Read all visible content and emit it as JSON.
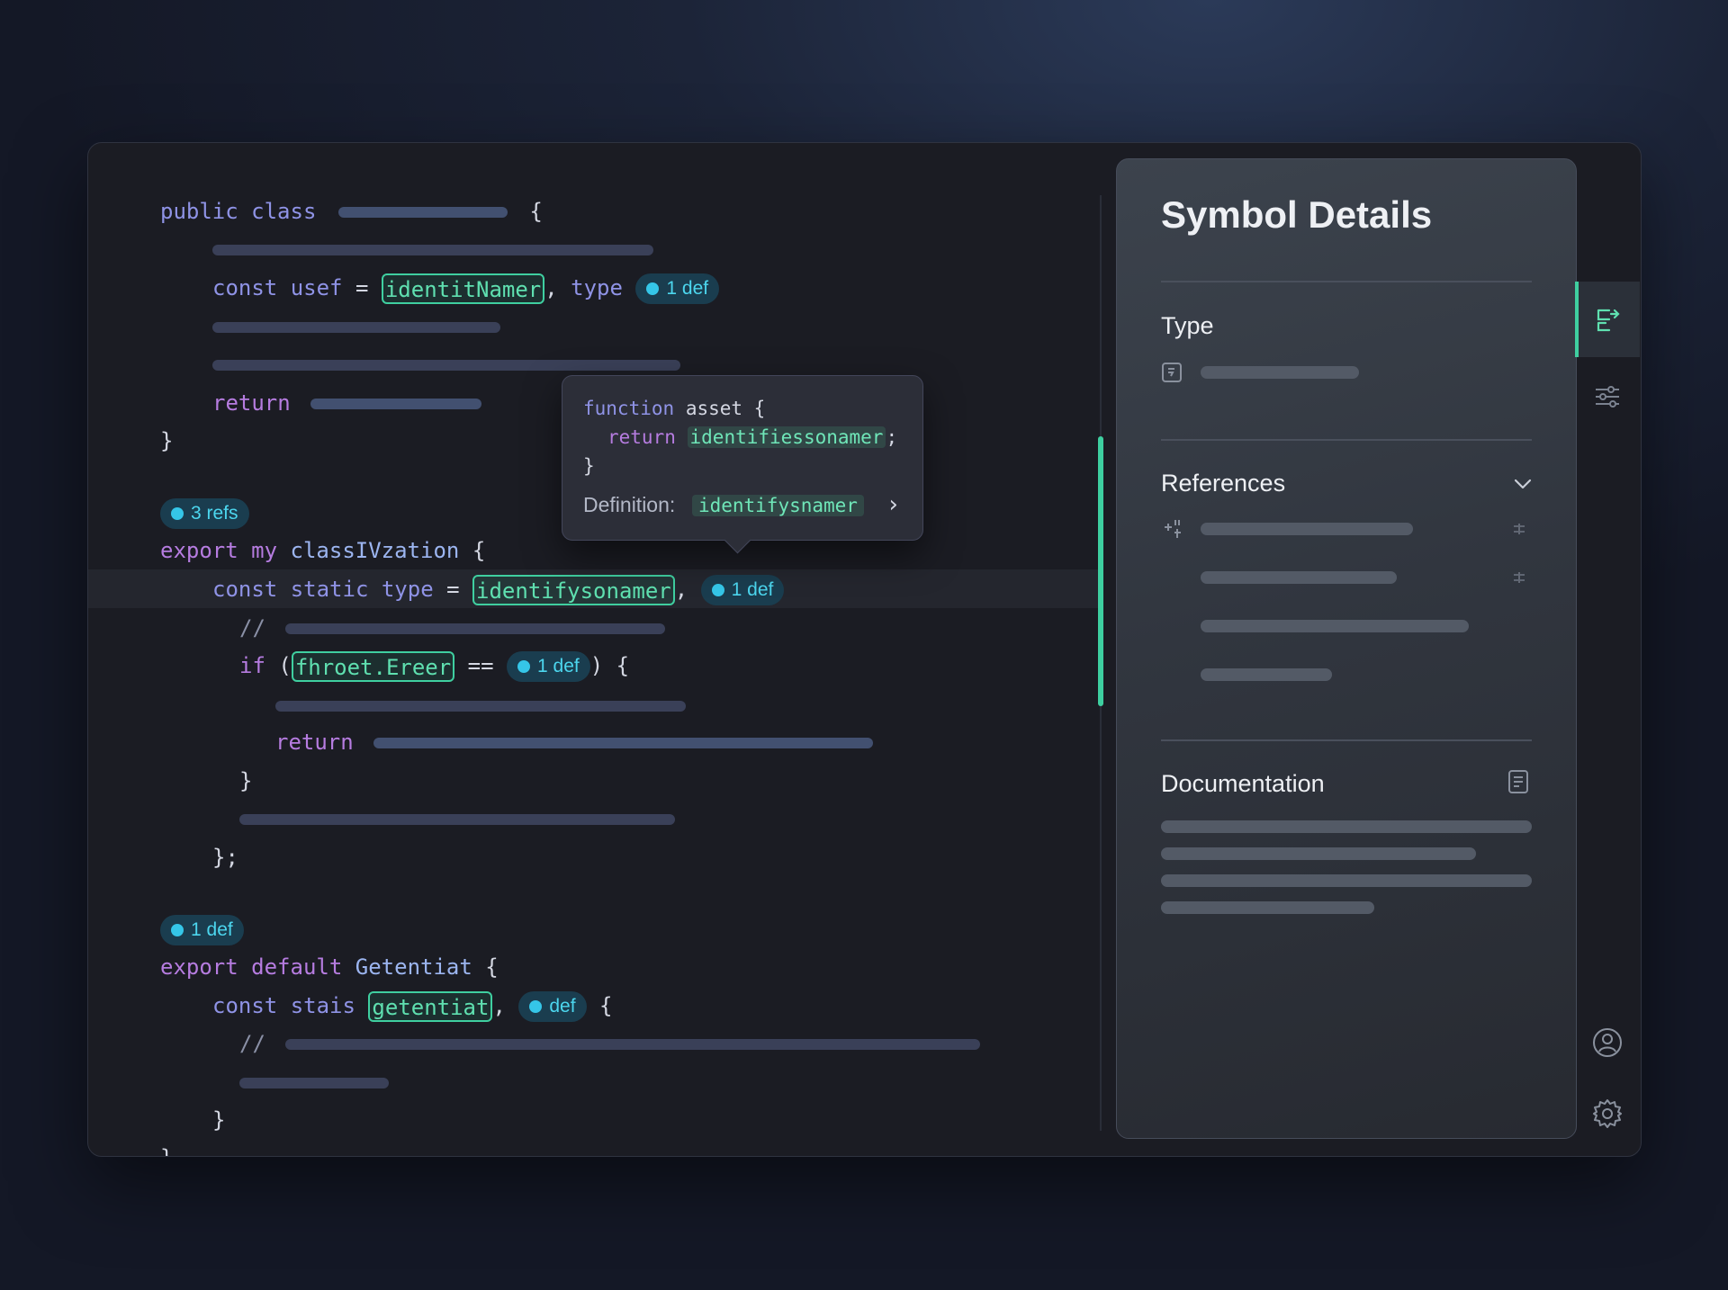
{
  "code": {
    "kw_public": "public",
    "kw_class": "class",
    "brace_open": "{",
    "brace_close": "}",
    "kw_const": "const",
    "var_usef": "usef",
    "eq": "=",
    "sym_identitNamer": "identitNamer",
    "comma": ",",
    "kw_type": "type",
    "kw_return": "return",
    "refs_badge": "3 refs",
    "kw_export": "export",
    "kw_my": "my",
    "cls_name": "classIVzation",
    "kw_static": "static",
    "sym_identifysonamer": "identifysonamer",
    "def_badge": "1 def",
    "comment": "//",
    "kw_if": "if",
    "paren_open": "(",
    "sym_fhroet": "fhroet.Ereer",
    "eqeq": "==",
    "paren_close_brace": ") {",
    "close_semi": "};",
    "kw_default": "default",
    "cls_getentiat": "Getentiat",
    "kw_stais": "stais",
    "sym_getentiat": "getentiat",
    "def_badge_short": "def",
    "partial_brace": "}"
  },
  "tooltip": {
    "kw_function": "function",
    "fn_name": "asset {",
    "kw_return": "return",
    "return_value": "identifiessonamer",
    "semi": ";",
    "close": "}",
    "definition_label": "Definition:",
    "definition_value": "identifysnamer",
    "chevron": "›"
  },
  "panel": {
    "title": "Symbol Details",
    "type_label": "Type",
    "references_label": "References",
    "documentation_label": "Documentation"
  },
  "rail": {
    "icons": [
      "symbol-details-icon",
      "filter-sliders-icon",
      "account-icon",
      "settings-gear-icon"
    ]
  },
  "colors": {
    "accent": "#3fcfa0",
    "badge": "#4cd6ee",
    "keyword": "#8f93e6",
    "keyword_purple": "#b67ce0",
    "panel_bg": "#353b44"
  }
}
